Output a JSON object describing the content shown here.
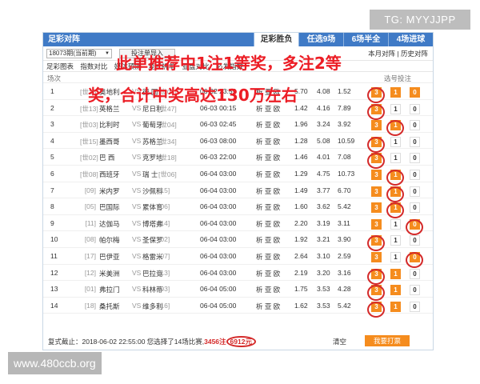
{
  "tg": "TG: MYYJJPP",
  "watermark": "www.480ccb.org",
  "title": "足彩对阵",
  "tabs": [
    "足彩胜负",
    "任选9场",
    "6场半全",
    "4场进球"
  ],
  "issue": "18073期(当前期)",
  "issue_button": "投注单导入",
  "top_links": "本月对阵 | 历史对阵",
  "subnav": [
    "足彩图表",
    "指数对比",
    "媒体预测",
    "复式拆单",
    "亚盘对比",
    "必发指数"
  ],
  "columns": {
    "num": "场次",
    "picks": "选号投注"
  },
  "overlay": {
    "line1": "此单推荐中1注1等奖，多注2等",
    "line2": "奖，合计中奖高达130万左右"
  },
  "vs_text": "VS",
  "lottery_text": "析 亚 欧",
  "pick_labels": [
    "3",
    "1",
    "0"
  ],
  "matches": [
    {
      "num": "1",
      "hrank": "[世26]",
      "home": "奥地利",
      "away": "德 国",
      "arank": "[世01]",
      "date": "06-02 23:59",
      "o": [
        "5.70",
        "4.08",
        "1.52"
      ],
      "sel": [
        1,
        1,
        1
      ],
      "ring": 0
    },
    {
      "num": "2",
      "hrank": "[世13]",
      "home": "英格兰",
      "away": "尼日利",
      "arank": "[世47]",
      "date": "06-03 00:15",
      "o": [
        "1.42",
        "4.16",
        "7.89"
      ],
      "sel": [
        1,
        0,
        0
      ],
      "ring": 0
    },
    {
      "num": "3",
      "hrank": "[世03]",
      "home": "比利时",
      "away": "葡萄牙",
      "arank": "[世04]",
      "date": "06-03 02:45",
      "o": [
        "1.96",
        "3.24",
        "3.92"
      ],
      "sel": [
        1,
        1,
        0
      ],
      "ring": 1
    },
    {
      "num": "4",
      "hrank": "[世15]",
      "home": "墨西哥",
      "away": "苏格兰",
      "arank": "[世34]",
      "date": "06-03 08:00",
      "o": [
        "1.28",
        "5.08",
        "10.59"
      ],
      "sel": [
        1,
        0,
        0
      ],
      "ring": 0
    },
    {
      "num": "5",
      "hrank": "[世02]",
      "home": "巴 西",
      "away": "克罗地",
      "arank": "[世18]",
      "date": "06-03 22:00",
      "o": [
        "1.46",
        "4.01",
        "7.08"
      ],
      "sel": [
        1,
        0,
        0
      ],
      "ring": 0
    },
    {
      "num": "6",
      "hrank": "[世08]",
      "home": "西班牙",
      "away": "瑞 士",
      "arank": "[世06]",
      "date": "06-04 03:00",
      "o": [
        "1.29",
        "4.75",
        "10.73"
      ],
      "sel": [
        1,
        1,
        0
      ],
      "ring": 1
    },
    {
      "num": "7",
      "hrank": "[09]",
      "home": "米内罗",
      "away": "沙佩科",
      "arank": "[15]",
      "date": "06-04 03:00",
      "o": [
        "1.49",
        "3.77",
        "6.70"
      ],
      "sel": [
        1,
        1,
        0
      ],
      "ring": 1
    },
    {
      "num": "8",
      "hrank": "[05]",
      "home": "巴国际",
      "away": "累体育",
      "arank": "[06]",
      "date": "06-04 03:00",
      "o": [
        "1.60",
        "3.62",
        "5.42"
      ],
      "sel": [
        1,
        1,
        0
      ],
      "ring": 1
    },
    {
      "num": "9",
      "hrank": "[11]",
      "home": "达伽马",
      "away": "博塔弗",
      "arank": "[14]",
      "date": "06-04 03:00",
      "o": [
        "2.20",
        "3.19",
        "3.11"
      ],
      "sel": [
        1,
        0,
        1
      ],
      "ring": 2
    },
    {
      "num": "10",
      "hrank": "[08]",
      "home": "帕尔梅",
      "away": "圣保罗",
      "arank": "[02]",
      "date": "06-04 03:00",
      "o": [
        "1.92",
        "3.21",
        "3.90"
      ],
      "sel": [
        1,
        0,
        0
      ],
      "ring": 0
    },
    {
      "num": "11",
      "hrank": "[17]",
      "home": "巴伊亚",
      "away": "格雷米",
      "arank": "[07]",
      "date": "06-04 03:00",
      "o": [
        "2.64",
        "3.10",
        "2.59"
      ],
      "sel": [
        1,
        0,
        1
      ],
      "ring": 2
    },
    {
      "num": "12",
      "hrank": "[12]",
      "home": "米美洲",
      "away": "巴拉竞",
      "arank": "[13]",
      "date": "06-04 03:00",
      "o": [
        "2.19",
        "3.20",
        "3.16"
      ],
      "sel": [
        1,
        1,
        0
      ],
      "ring": 0
    },
    {
      "num": "13",
      "hrank": "[01]",
      "home": "弗拉门",
      "away": "科林蒂",
      "arank": "[03]",
      "date": "06-04 05:00",
      "o": [
        "1.75",
        "3.53",
        "4.28"
      ],
      "sel": [
        1,
        1,
        0
      ],
      "ring": 0
    },
    {
      "num": "14",
      "hrank": "[18]",
      "home": "桑托斯",
      "away": "维多利",
      "arank": "[16]",
      "date": "06-04 05:00",
      "o": [
        "1.62",
        "3.53",
        "5.42"
      ],
      "sel": [
        1,
        1,
        0
      ],
      "ring": 0
    }
  ],
  "footer": {
    "text": "复式截止：2018-06-02 22:55:00 您选择了14场比赛,",
    "bets": "3456注",
    "amount": "6912元",
    "clear": "清空",
    "buy": "我要打票"
  },
  "colors": {
    "header": "#3f7ac6",
    "pick": "#f58c1e",
    "overlay": "#ec1d25"
  }
}
